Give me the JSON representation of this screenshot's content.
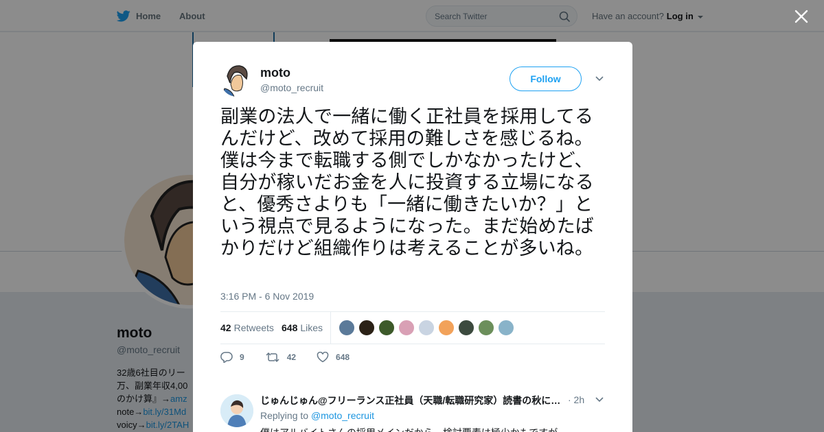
{
  "nav": {
    "home_label": "Home",
    "about_label": "About",
    "search_placeholder": "Search Twitter",
    "account_prompt": "Have an account?",
    "login_label": "Log in"
  },
  "profile": {
    "name": "moto",
    "handle": "@moto_recruit",
    "bio_line1": "32歳6社目のリー",
    "bio_line2": "万、副業年収4,00",
    "bio_line3": "のかけ算』→",
    "bio_line3_link": "amz",
    "bio_line4_label": "note→",
    "bio_line4_link": "bit.ly/31Md",
    "bio_line5_label": "voicy→",
    "bio_line5_link": "bit.ly/2TAH"
  },
  "tweet": {
    "author_name": "moto",
    "author_handle": "@moto_recruit",
    "follow_label": "Follow",
    "text": "副業の法人で一緒に働く正社員を採用してるんだけど、改めて採用の難しさを感じるね。僕は今まで転職する側でしかなかったけど、自分が稼いだお金を人に投資する立場になると、優秀さよりも「一緒に働きたいか？」という視点で見るようになった。まだ始めたばかりだけど組織作りは考えることが多いね。",
    "timestamp": "3:16 PM - 6 Nov 2019",
    "retweets_count": "42",
    "retweets_label": "Retweets",
    "likes_count": "648",
    "likes_label": "Likes",
    "reply_count": "9",
    "retweet_action_count": "42",
    "like_action_count": "648",
    "liker_colors": [
      "#5b7a99",
      "#2b2116",
      "#3d5a2a",
      "#d9a0b5",
      "#c9d4e2",
      "#f2a25a",
      "#3c4a3e",
      "#6c8f5b",
      "#89b3c9"
    ]
  },
  "reply": {
    "name": "じゅんじゅん@フリーランス正社員（天職/転職研究家）読書の秋に…",
    "time": "· 2h",
    "replying_to_label": "Replying to",
    "replying_to_handle": "@moto_recruit",
    "body": "僕はアルバイトさんの採用メインだから、検討要素は極少かもですが"
  },
  "colors": {
    "accent": "#1da1f2",
    "link": "#1b95e0",
    "muted": "#657786"
  }
}
